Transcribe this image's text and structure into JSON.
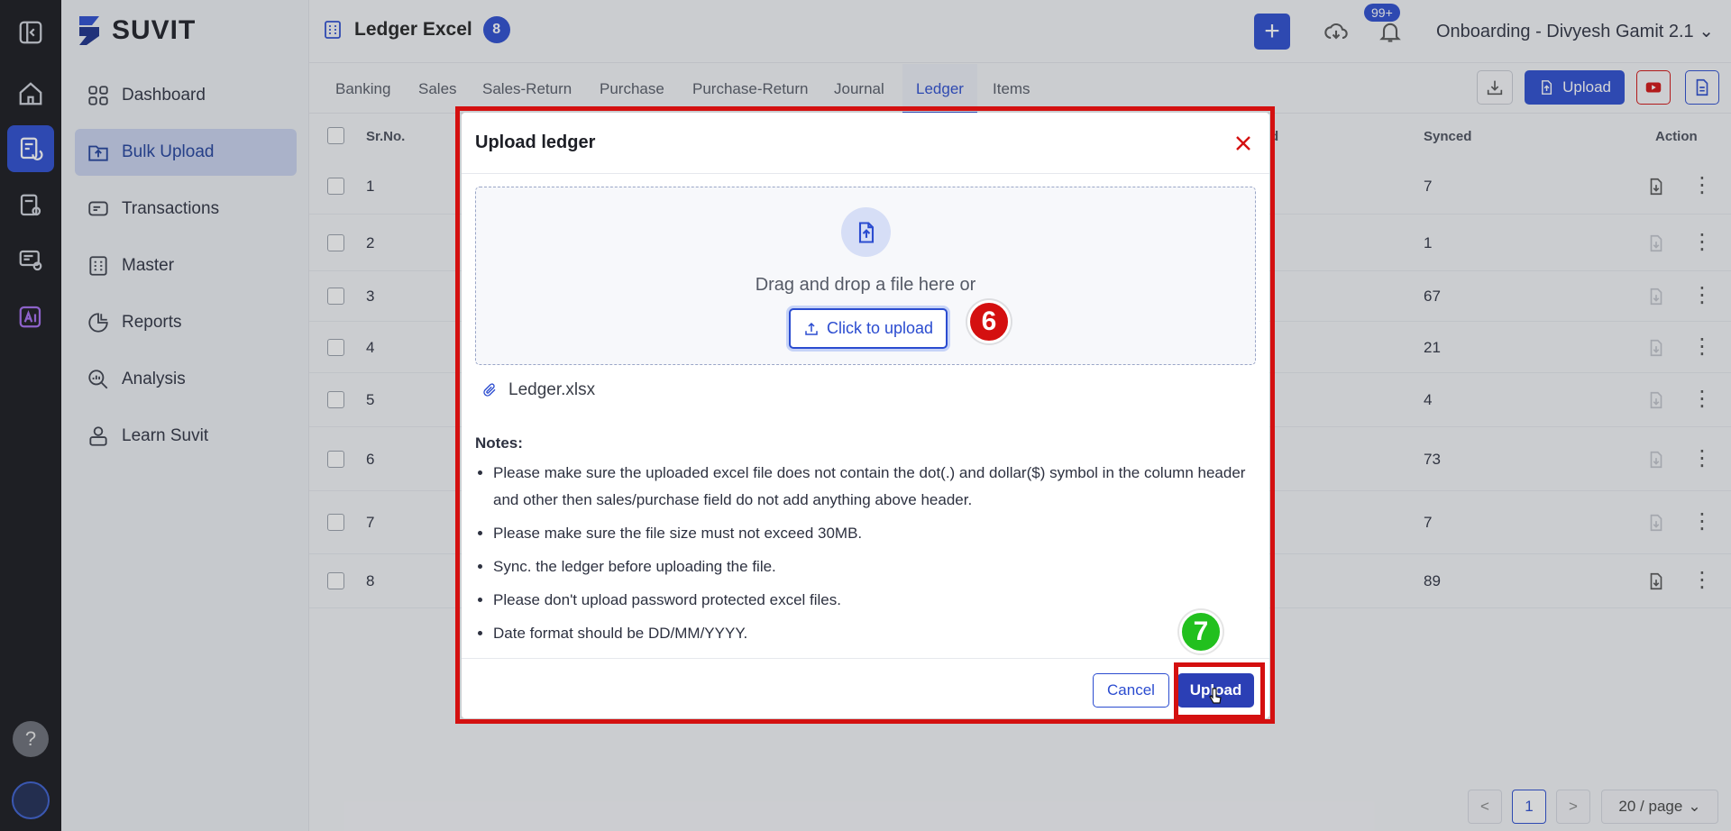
{
  "brand": {
    "name": "SUVIT"
  },
  "sidebar": {
    "items": [
      {
        "label": "Dashboard",
        "icon": "grid-icon"
      },
      {
        "label": "Bulk Upload",
        "icon": "upload-folder-icon",
        "active": true
      },
      {
        "label": "Transactions",
        "icon": "transactions-icon"
      },
      {
        "label": "Master",
        "icon": "master-icon"
      },
      {
        "label": "Reports",
        "icon": "pie-chart-icon"
      },
      {
        "label": "Analysis",
        "icon": "analysis-icon"
      },
      {
        "label": "Learn Suvit",
        "icon": "learn-icon"
      }
    ]
  },
  "rail": {
    "help": "?"
  },
  "header": {
    "title": "Ledger Excel",
    "count": "8",
    "notifications": "99+",
    "workspace": "Onboarding - Divyesh Gamit 2.1"
  },
  "tabs": [
    "Banking",
    "Sales",
    "Sales-Return",
    "Purchase",
    "Purchase-Return",
    "Journal",
    "Ledger",
    "Items"
  ],
  "active_tab": "Ledger",
  "toolbar": {
    "upload_label": "Upload"
  },
  "table": {
    "columns": {
      "srno": "Sr.No.",
      "partial": "d",
      "synced": "Synced",
      "action": "Action"
    },
    "rows": [
      {
        "sr": "1",
        "synced": "7",
        "download_enabled": true
      },
      {
        "sr": "2",
        "synced": "1",
        "download_enabled": false
      },
      {
        "sr": "3",
        "synced": "67",
        "download_enabled": false
      },
      {
        "sr": "4",
        "synced": "21",
        "download_enabled": false
      },
      {
        "sr": "5",
        "synced": "4",
        "download_enabled": false
      },
      {
        "sr": "6",
        "synced": "73",
        "download_enabled": false
      },
      {
        "sr": "7",
        "synced": "7",
        "download_enabled": false
      },
      {
        "sr": "8",
        "synced": "89",
        "download_enabled": true
      }
    ]
  },
  "pagination": {
    "prev": "<",
    "current": "1",
    "next": ">",
    "page_size": "20 / page"
  },
  "modal": {
    "title": "Upload ledger",
    "dropzone_text": "Drag and drop a file here or",
    "click_to_upload": "Click to upload",
    "file_name": "Ledger.xlsx",
    "notes_title": "Notes:",
    "notes": [
      "Please make sure the uploaded excel file does not contain the dot(.) and dollar($) symbol in the column header and other then sales/purchase field do not add anything above header.",
      "Please make sure the file size must not exceed 30MB.",
      "Sync. the ledger before uploading the file.",
      "Please don't upload password protected excel files.",
      "Date format should be DD/MM/YYYY."
    ],
    "cancel_label": "Cancel",
    "upload_label": "Upload"
  },
  "annotations": {
    "step6": {
      "label": "6",
      "color": "#d41010"
    },
    "step7": {
      "label": "7",
      "color": "#22c01e"
    }
  },
  "colors": {
    "primary": "#2b4cd0",
    "highlight_frame": "#d41010"
  }
}
